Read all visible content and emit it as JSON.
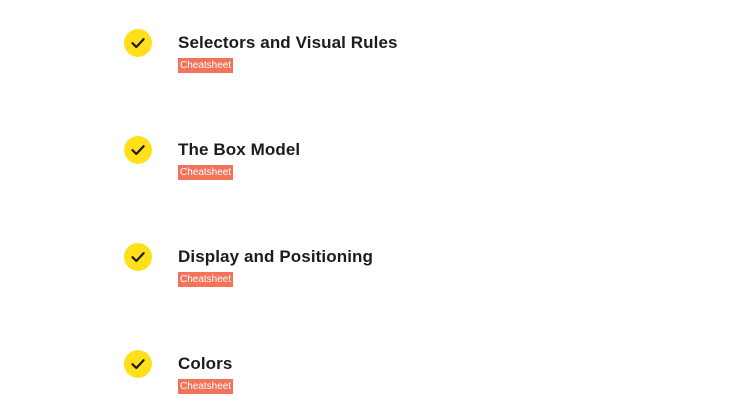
{
  "lessons": [
    {
      "title": "Selectors and Visual Rules",
      "tag": "Cheatsheet",
      "completed": true
    },
    {
      "title": "The Box Model",
      "tag": "Cheatsheet",
      "completed": true
    },
    {
      "title": "Display and Positioning",
      "tag": "Cheatsheet",
      "completed": true
    },
    {
      "title": "Colors",
      "tag": "Cheatsheet",
      "completed": true
    }
  ],
  "colors": {
    "check_fill": "#ffe01a",
    "check_mark": "#1c1c1c",
    "tag_background": "#f2735a",
    "tag_text": "#ffffff"
  },
  "icons": {
    "completed": "check-circle-icon"
  }
}
